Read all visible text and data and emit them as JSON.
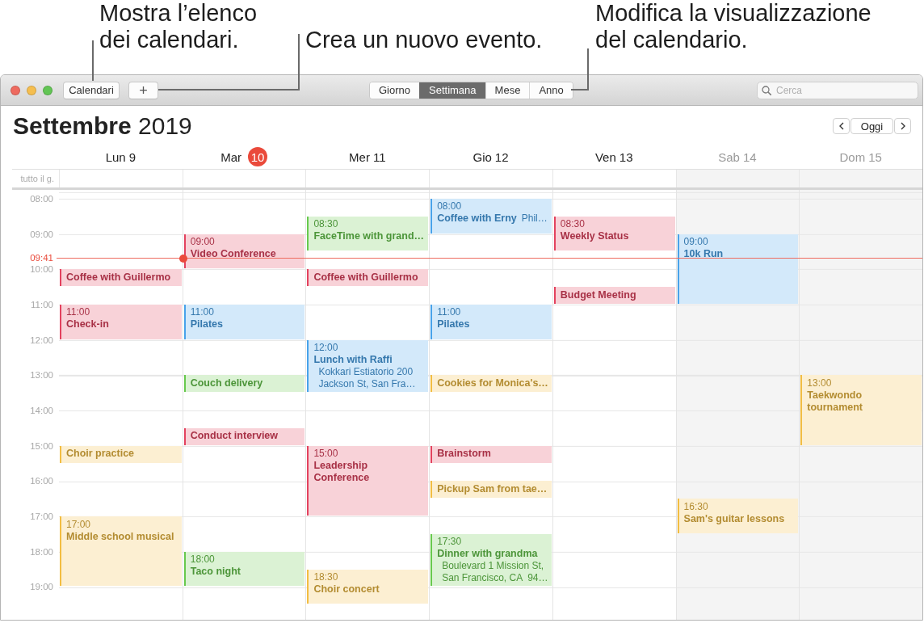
{
  "callouts": [
    "Mostra l’elenco dei calendari.",
    "Crea un nuovo evento.",
    "Modifica la visualizzazione del calendario."
  ],
  "toolbar": {
    "calendars_button": "Calendari",
    "add_button": "+",
    "views": [
      {
        "label": "Giorno",
        "selected": false
      },
      {
        "label": "Settimana",
        "selected": true
      },
      {
        "label": "Mese",
        "selected": false
      },
      {
        "label": "Anno",
        "selected": false
      }
    ],
    "search": {
      "placeholder": "Cerca"
    }
  },
  "header": {
    "title": "**Settembre** 2019",
    "today_button": "Oggi"
  },
  "all_day_label": "tutto il g.",
  "hours": [
    "08:00",
    "09:00",
    "10:00",
    "11:00",
    "12:00",
    "13:00",
    "14:00",
    "15:00",
    "16:00",
    "17:00",
    "18:00",
    "19:00"
  ],
  "current_time": "09:41",
  "days": [
    {
      "name": "Lun",
      "number": "9",
      "today": false,
      "weekend": false,
      "timeline": [
        {
          "kind": "free"
        },
        {
          "kind": "free"
        },
        {
          "kind": "free"
        },
        {
          "kind": "free"
        },
        {
          "kind": "half",
          "title": "Coffee with Guillermo",
          "color": "#e3425e"
        },
        {
          "kind": "free"
        },
        {
          "kind": "hour",
          "time": "11:00",
          "title": "Check-in",
          "color": "#e3425e"
        },
        {
          "kind": "free"
        },
        {
          "kind": "free"
        },
        {
          "kind": "free"
        },
        {
          "kind": "free"
        },
        {
          "kind": "free"
        },
        {
          "kind": "free"
        },
        {
          "kind": "half",
          "title": "Choir practice",
          "color": "#f2bd42"
        },
        {
          "kind": "free"
        },
        {
          "kind": "free"
        },
        {
          "kind": "free"
        },
        {
          "kind": "double",
          "time": "17:00",
          "title": "Middle school musical",
          "color": "#f2bd42"
        }
      ]
    },
    {
      "name": "Mar",
      "number": "10",
      "today": true,
      "weekend": false,
      "timeline": [
        {
          "kind": "free"
        },
        {
          "kind": "free"
        },
        {
          "kind": "hour",
          "time": "09:00",
          "title": "Video Conference",
          "color": "#e3425e"
        },
        {
          "kind": "free"
        },
        {
          "kind": "free"
        },
        {
          "kind": "hour",
          "time": "11:00",
          "title": "Pilates",
          "color": "#48a2ea"
        },
        {
          "kind": "free"
        },
        {
          "kind": "free"
        },
        {
          "kind": "half",
          "title": "Couch delivery",
          "color": "#67c94d"
        },
        {
          "kind": "free"
        },
        {
          "kind": "free"
        },
        {
          "kind": "half",
          "title": "Conduct interview",
          "color": "#e3425e"
        },
        {
          "kind": "free"
        },
        {
          "kind": "free"
        },
        {
          "kind": "free"
        },
        {
          "kind": "free"
        },
        {
          "kind": "free"
        },
        {
          "kind": "free"
        },
        {
          "kind": "hour",
          "time": "18:00",
          "title": "Taco night",
          "color": "#67c94d"
        }
      ]
    },
    {
      "name": "Mer",
      "number": "11",
      "today": false,
      "weekend": false,
      "timeline": [
        {
          "kind": "free"
        },
        {
          "kind": "hour",
          "time": "08:30",
          "title": "FaceTime with grand…",
          "color": "#67c94d"
        },
        {
          "kind": "free"
        },
        {
          "kind": "half",
          "title": "Coffee with Guillermo",
          "color": "#e3425e"
        },
        {
          "kind": "free"
        },
        {
          "kind": "free"
        },
        {
          "kind": "free"
        },
        {
          "kind": "ninety",
          "time": "12:00",
          "title": "Lunch with Raffi",
          "location": "Kokkari Estiatorio 200 Jackson St, San Fra…",
          "color": "#48a2ea"
        },
        {
          "kind": "free"
        },
        {
          "kind": "free"
        },
        {
          "kind": "free"
        },
        {
          "kind": "double",
          "time": "15:00",
          "title": "Leadership Conference",
          "color": "#e3425e"
        },
        {
          "kind": "free"
        },
        {
          "kind": "free"
        },
        {
          "kind": "free"
        },
        {
          "kind": "hour",
          "time": "18:30",
          "title": "Choir concert",
          "color": "#f2bd42"
        }
      ]
    },
    {
      "name": "Gio",
      "number": "12",
      "today": false,
      "weekend": false,
      "timeline": [
        {
          "kind": "hour",
          "time": "08:00",
          "title": "Coffee with Erny",
          "location": "Phil…",
          "color": "#48a2ea"
        },
        {
          "kind": "free"
        },
        {
          "kind": "free"
        },
        {
          "kind": "free"
        },
        {
          "kind": "free"
        },
        {
          "kind": "hour",
          "time": "11:00",
          "title": "Pilates",
          "color": "#48a2ea"
        },
        {
          "kind": "free"
        },
        {
          "kind": "free"
        },
        {
          "kind": "half",
          "title": "Cookies for Monica's…",
          "color": "#f2bd42"
        },
        {
          "kind": "free"
        },
        {
          "kind": "free"
        },
        {
          "kind": "free"
        },
        {
          "kind": "half",
          "title": "Brainstorm",
          "color": "#e3425e"
        },
        {
          "kind": "free"
        },
        {
          "kind": "half",
          "title": "Pickup Sam from tae…",
          "color": "#f2bd42"
        },
        {
          "kind": "free"
        },
        {
          "kind": "free"
        },
        {
          "kind": "ninety",
          "time": "17:30",
          "title": "Dinner with grandma",
          "location": "Boulevard 1 Mission St, San Francisco, CA  94…",
          "color": "#67c94d"
        }
      ]
    },
    {
      "name": "Ven",
      "number": "13",
      "today": false,
      "weekend": false,
      "timeline": [
        {
          "kind": "free"
        },
        {
          "kind": "hour",
          "time": "08:30",
          "title": "Weekly Status",
          "color": "#e3425e"
        },
        {
          "kind": "free"
        },
        {
          "kind": "free"
        },
        {
          "kind": "half",
          "title": "Budget Meeting",
          "color": "#e3425e"
        }
      ]
    },
    {
      "name": "Sab",
      "number": "14",
      "today": false,
      "weekend": true,
      "timeline": [
        {
          "kind": "free"
        },
        {
          "kind": "free"
        },
        {
          "kind": "double",
          "time": "09:00",
          "title": "10k Run",
          "color": "#48a2ea"
        },
        {
          "kind": "free"
        },
        {
          "kind": "free"
        },
        {
          "kind": "free"
        },
        {
          "kind": "free"
        },
        {
          "kind": "free"
        },
        {
          "kind": "free"
        },
        {
          "kind": "free"
        },
        {
          "kind": "free"
        },
        {
          "kind": "free"
        },
        {
          "kind": "free"
        },
        {
          "kind": "free"
        },
        {
          "kind": "hour",
          "time": "16:30",
          "title": "Sam's guitar lessons",
          "color": "#f2bd42"
        }
      ]
    },
    {
      "name": "Dom",
      "number": "15",
      "today": false,
      "weekend": true,
      "timeline": [
        {
          "kind": "free"
        },
        {
          "kind": "free"
        },
        {
          "kind": "free"
        },
        {
          "kind": "free"
        },
        {
          "kind": "free"
        },
        {
          "kind": "free"
        },
        {
          "kind": "free"
        },
        {
          "kind": "free"
        },
        {
          "kind": "free"
        },
        {
          "kind": "free"
        },
        {
          "kind": "double",
          "time": "13:00",
          "title": "Taekwondo tournament",
          "color": "#f2bd42"
        }
      ]
    }
  ]
}
